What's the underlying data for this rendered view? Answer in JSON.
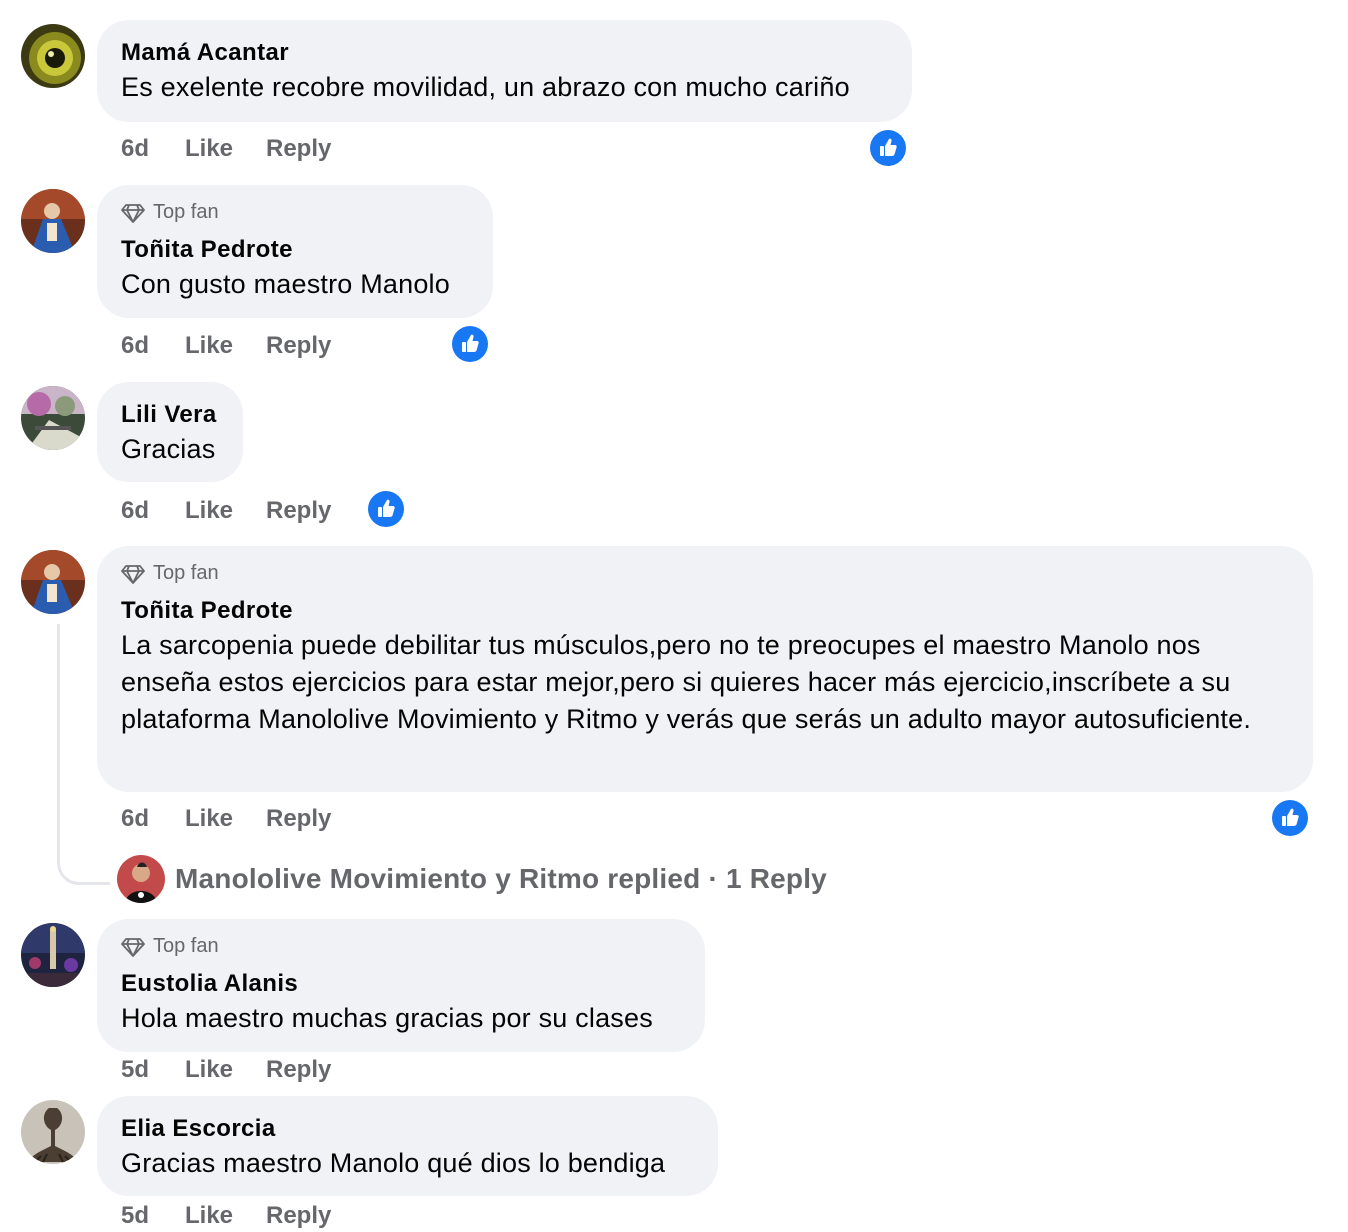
{
  "comments": [
    {
      "author": "Mamá Acantar",
      "badge": "",
      "text": "Es exelente recobre movilidad, un abrazo con mucho cariño",
      "time": "6d",
      "like": "Like",
      "reply": "Reply"
    },
    {
      "author": "Toñita Pedrote",
      "badge": "Top fan",
      "text": "Con gusto maestro Manolo",
      "time": "6d",
      "like": "Like",
      "reply": "Reply"
    },
    {
      "author": "Lili Vera",
      "badge": "",
      "text": "Gracias",
      "time": "6d",
      "like": "Like",
      "reply": "Reply"
    },
    {
      "author": "Toñita Pedrote",
      "badge": "Top fan",
      "text": "La sarcopenia puede debilitar tus músculos,pero no te preocupes el maestro Manolo nos enseña estos ejercicios para estar mejor,pero si quieres hacer más ejercicio,inscríbete a su plataforma Manololive Movimiento y Ritmo y verás que serás un adulto mayor autosuficiente.",
      "time": "6d",
      "like": "Like",
      "reply": "Reply",
      "replies_summary": "Manololive Movimiento y Ritmo replied · 1 Reply"
    },
    {
      "author": "Eustolia Alanis",
      "badge": "Top fan",
      "text": "Hola maestro muchas gracias por su clases",
      "time": "5d",
      "like": "Like",
      "reply": "Reply"
    },
    {
      "author": "Elia Escorcia",
      "badge": "",
      "text": "Gracias maestro Manolo qué dios lo bendiga",
      "time": "5d",
      "like": "Like",
      "reply": "Reply"
    }
  ],
  "icons": {
    "badge": "diamond-icon",
    "reaction": "thumbs-up-reaction-icon"
  },
  "colors": {
    "bubble": "#f0f2f5",
    "secondary_text": "#65676b",
    "like_blue": "#1877f2"
  }
}
